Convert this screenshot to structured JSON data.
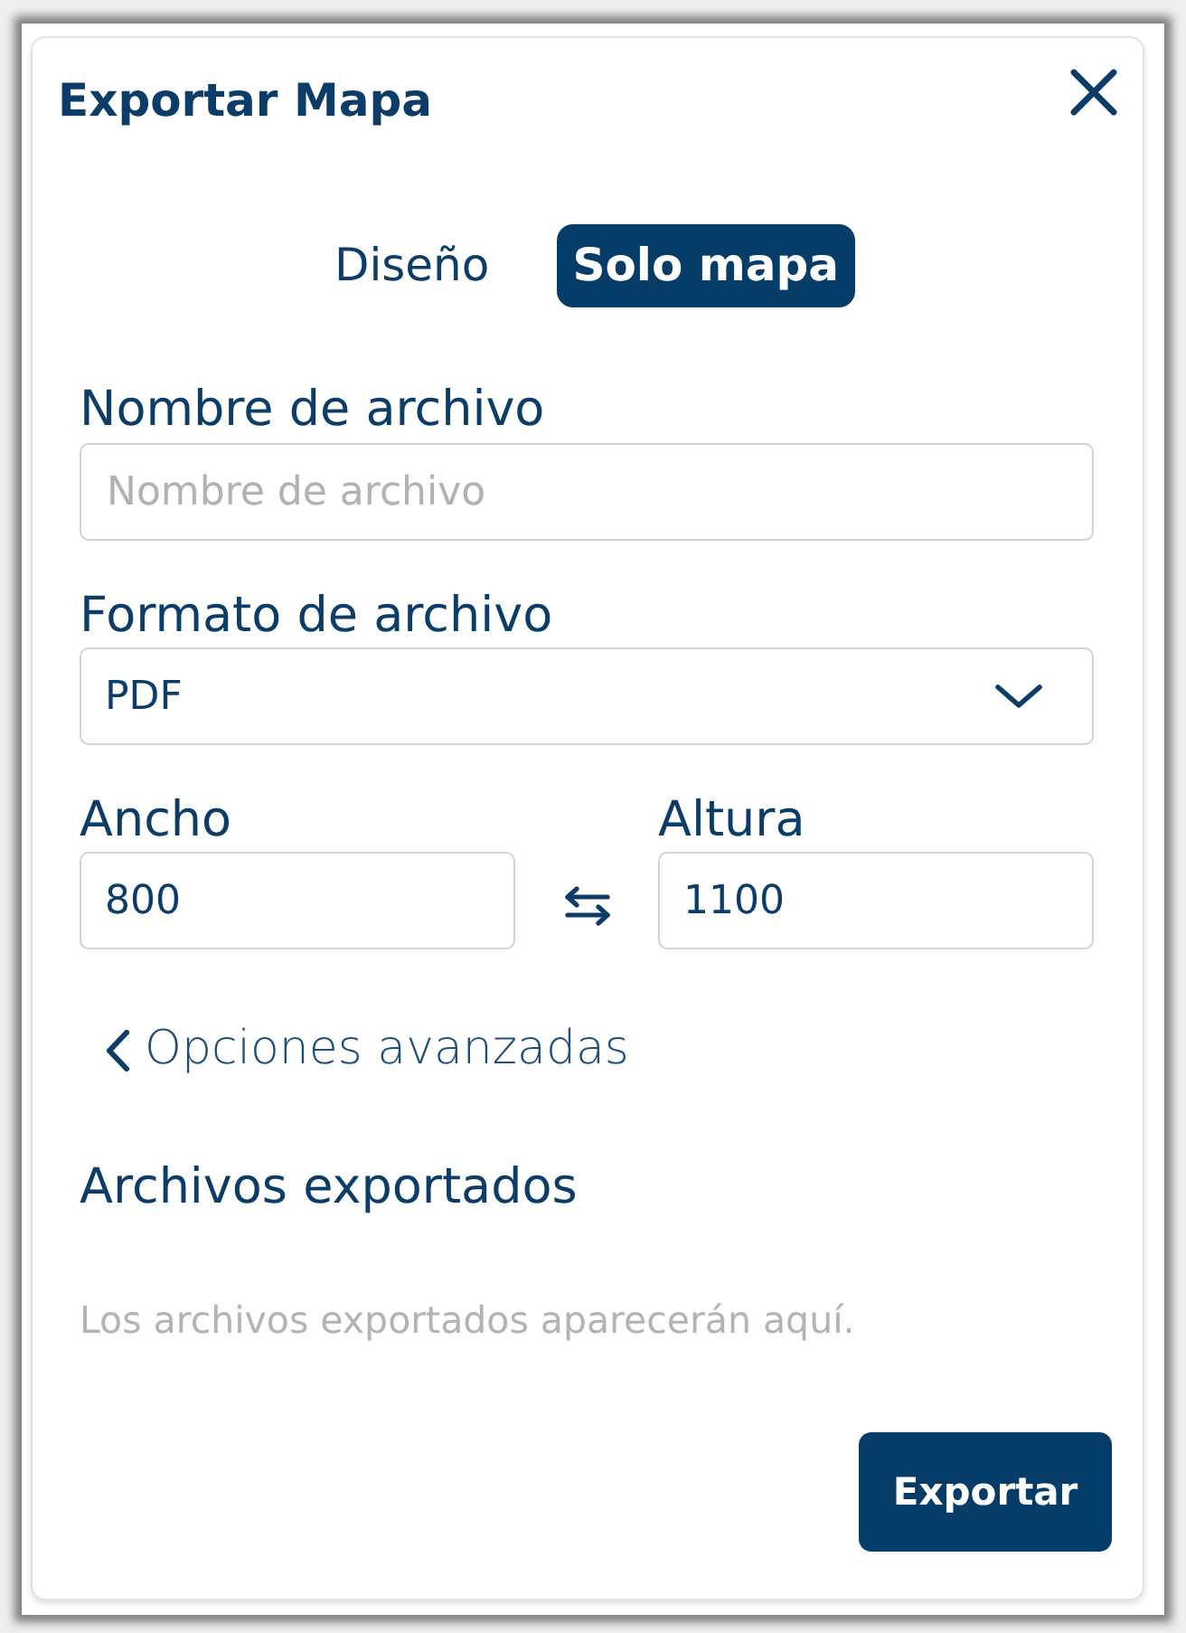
{
  "dialog": {
    "title": "Exportar Mapa"
  },
  "tabs": [
    {
      "label": "Diseño",
      "selected": false
    },
    {
      "label": "Solo mapa",
      "selected": true
    }
  ],
  "fields": [
    {
      "kind": "text",
      "label": "Nombre de archivo",
      "placeholder": "Nombre de archivo"
    },
    {
      "kind": "select",
      "label": "Formato de archivo",
      "value": "PDF"
    }
  ],
  "size": [
    {
      "label": "Ancho",
      "value": "800"
    },
    {
      "label": "Altura",
      "value": "1100"
    }
  ],
  "advanced_options": {
    "label": "Opciones avanzadas",
    "expanded": false
  },
  "exported_files": {
    "title": "Archivos exportados",
    "empty_message": "Los archivos exportados aparecerán aquí."
  },
  "export_button": {
    "label": "Exportar"
  }
}
